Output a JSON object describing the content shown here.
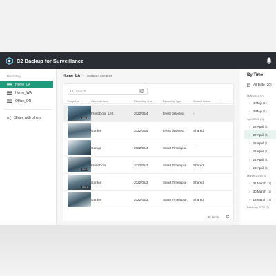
{
  "app": {
    "title": "C2 Backup for Surveillance"
  },
  "sidebar": {
    "section": "Recording",
    "items": [
      {
        "label": "Home_LA"
      },
      {
        "label": "Home_WA"
      },
      {
        "label": "Office_OR"
      }
    ],
    "share_label": "Share with others"
  },
  "main": {
    "title": "Home_LA",
    "subtitle": "Assign 4 cameras",
    "search_placeholder": "Search",
    "columns": [
      "Snapshot",
      "Camera name",
      "Recording time",
      "Recording type",
      "Shared status"
    ],
    "rows": [
      {
        "thumb_time": "13:01",
        "name": "Front Door_Left",
        "time": "2022/05/4",
        "type": "Event detected",
        "status": "-"
      },
      {
        "thumb_time": "",
        "name": "Garden",
        "time": "2022/05/4",
        "type": "Event detected",
        "status": "Shared"
      },
      {
        "thumb_time": "",
        "name": "Garage",
        "time": "2022/05/4",
        "type": "Smart Timelapse",
        "status": "-"
      },
      {
        "thumb_time": "13:01",
        "name": "Front Door",
        "time": "2022/05/3",
        "type": "Smart Timelapse",
        "status": "Shared"
      },
      {
        "thumb_time": "13:01",
        "name": "Garden",
        "time": "2022/05/3",
        "type": "Smart Timelapse",
        "status": "Shared"
      },
      {
        "thumb_time": "",
        "name": "Garden",
        "time": "2022/05/3",
        "type": "Smart Timelapse",
        "status": "Shared"
      }
    ],
    "footer": "20 items"
  },
  "right_panel": {
    "title": "By Time",
    "all_date": "All Date (20)",
    "groups": [
      {
        "month": "May 2022 (3)",
        "days": [
          {
            "day": "4 May",
            "count": "(1)"
          },
          {
            "day": "3 May",
            "count": "(1)"
          }
        ]
      },
      {
        "month": "April 2022 (9)",
        "days": [
          {
            "day": "28 April",
            "count": "(1)"
          },
          {
            "day": "27 April",
            "count": "(1)"
          },
          {
            "day": "26 April",
            "count": "(1)"
          },
          {
            "day": "25 April",
            "count": "(1)"
          },
          {
            "day": "24 April",
            "count": "(1)"
          },
          {
            "day": "23 April",
            "count": "(1)"
          }
        ]
      },
      {
        "month": "March 2022 (6)",
        "days": [
          {
            "day": "31 March",
            "count": "(1)"
          },
          {
            "day": "30 March",
            "count": "(1)"
          },
          {
            "day": "19 March",
            "count": "(1)"
          }
        ]
      },
      {
        "month": "February 2022 (2)",
        "days": []
      }
    ]
  },
  "colors": {
    "accent": "#1f9a7a",
    "appbar": "#2a2d34"
  }
}
